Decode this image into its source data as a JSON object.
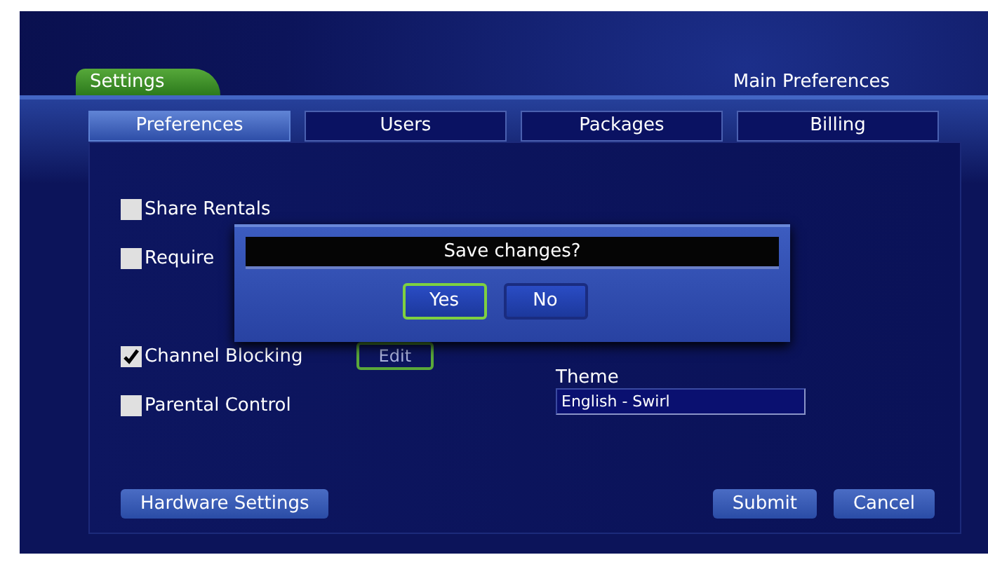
{
  "header": {
    "section_tab": "Settings",
    "title": "Main Preferences"
  },
  "tabs": [
    {
      "label": "Preferences",
      "selected": true
    },
    {
      "label": "Users",
      "selected": false
    },
    {
      "label": "Packages",
      "selected": false
    },
    {
      "label": "Billing",
      "selected": false
    }
  ],
  "options": [
    {
      "label": "Share Rentals",
      "checked": false
    },
    {
      "label": "Require",
      "checked": false
    },
    {
      "label": "Channel Blocking",
      "checked": true,
      "button": "Edit"
    },
    {
      "label": "Parental Control",
      "checked": false
    }
  ],
  "theme": {
    "label": "Theme",
    "value": "English - Swirl"
  },
  "buttons_left": [
    "Hardware Settings"
  ],
  "buttons_right": [
    "Submit",
    "Cancel"
  ],
  "dialog": {
    "title": "Save changes?",
    "buttons": [
      {
        "label": "Yes",
        "selected": true
      },
      {
        "label": "No",
        "selected": false
      }
    ]
  }
}
